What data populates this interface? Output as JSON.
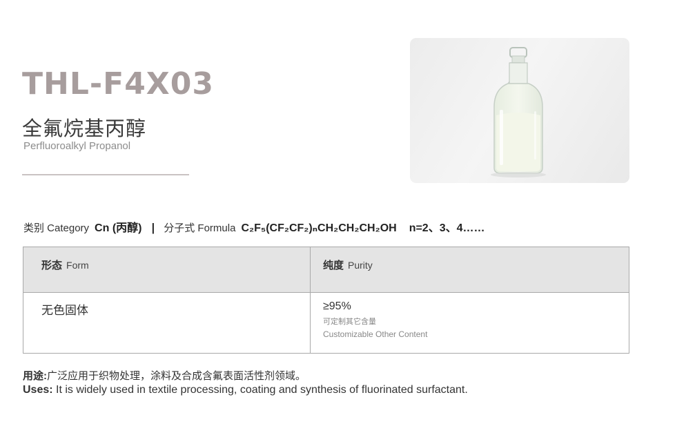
{
  "product": {
    "code": "THL-F4X03",
    "name_cn": "全氟烷基丙醇",
    "name_en": "Perfluoroalkyl Propanol"
  },
  "info": {
    "category_label": "类别 Category",
    "category_value": "Cn (丙醇)",
    "separator": "|",
    "formula_label": "分子式 Formula",
    "formula_value": "C₂F₅(CF₂CF₂)ₙCH₂CH₂CH₂OH",
    "n_value": "n=2、3、4……"
  },
  "table": {
    "form_header_cn": "形态",
    "form_header_en": "Form",
    "purity_header_cn": "纯度",
    "purity_header_en": "Purity",
    "form_value": "无色固体",
    "purity_value": "≥95%",
    "purity_note_cn": "可定制其它含量",
    "purity_note_en": "Customizable Other Content"
  },
  "uses": {
    "label_cn": "用途:",
    "text_cn": "广泛应用于织物处理，涂料及合成含氟表面活性剂领域。",
    "label_en": "Uses:",
    "text_en": "It is widely used in textile processing, coating and synthesis of fluorinated surfactant."
  },
  "photo": {
    "icon": "glass-reagent-bottle-icon"
  }
}
